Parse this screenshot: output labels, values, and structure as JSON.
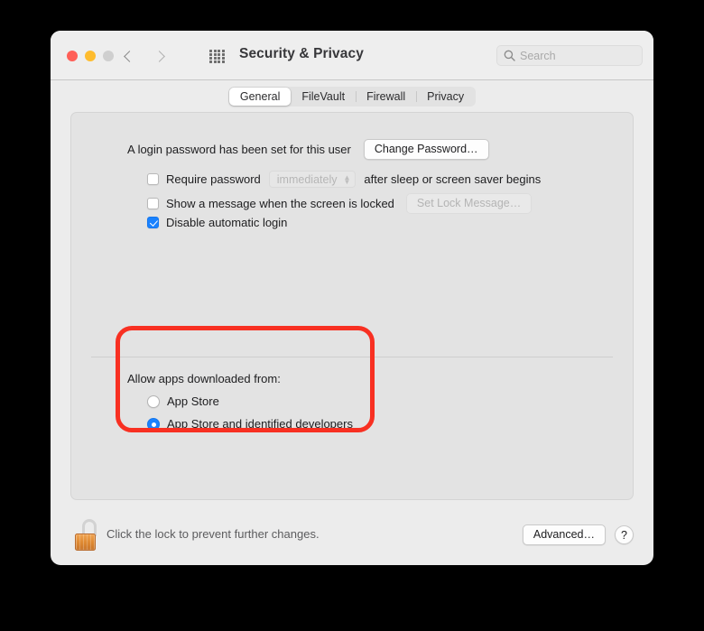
{
  "window": {
    "title": "Security & Privacy",
    "traffic_lights": [
      "close-red",
      "minimize-yellow",
      "zoom-grey"
    ],
    "nav": {
      "back": "‹",
      "forward": "›"
    },
    "grid_icon": "show-all-grid-icon",
    "search": {
      "placeholder": "Search",
      "value": "",
      "icon": "search-icon"
    }
  },
  "tabs": [
    {
      "label": "General",
      "active": true
    },
    {
      "label": "FileVault",
      "active": false
    },
    {
      "label": "Firewall",
      "active": false
    },
    {
      "label": "Privacy",
      "active": false
    }
  ],
  "general": {
    "password_status": "A login password has been set for this user",
    "change_password_label": "Change Password…",
    "require_password": {
      "checked": false,
      "label_before": "Require password",
      "interval_value": "immediately",
      "label_after": "after sleep or screen saver begins",
      "disabled": true
    },
    "lock_message": {
      "checked": false,
      "label": "Show a message when the screen is locked",
      "button_label": "Set Lock Message…",
      "button_disabled": true
    },
    "disable_auto_login": {
      "checked": true,
      "label": "Disable automatic login"
    },
    "allow_apps": {
      "title": "Allow apps downloaded from:",
      "options": [
        {
          "label": "App Store",
          "selected": false
        },
        {
          "label": "App Store and identified developers",
          "selected": true
        }
      ]
    }
  },
  "footer": {
    "lock_icon": "lock-open-icon",
    "lock_text": "Click the lock to prevent further changes.",
    "advanced_label": "Advanced…",
    "help_label": "?"
  },
  "annotation": {
    "shape": "rounded-rectangle-highlight",
    "color": "#f83022",
    "targets": "allow-apps-downloaded-from-section"
  }
}
